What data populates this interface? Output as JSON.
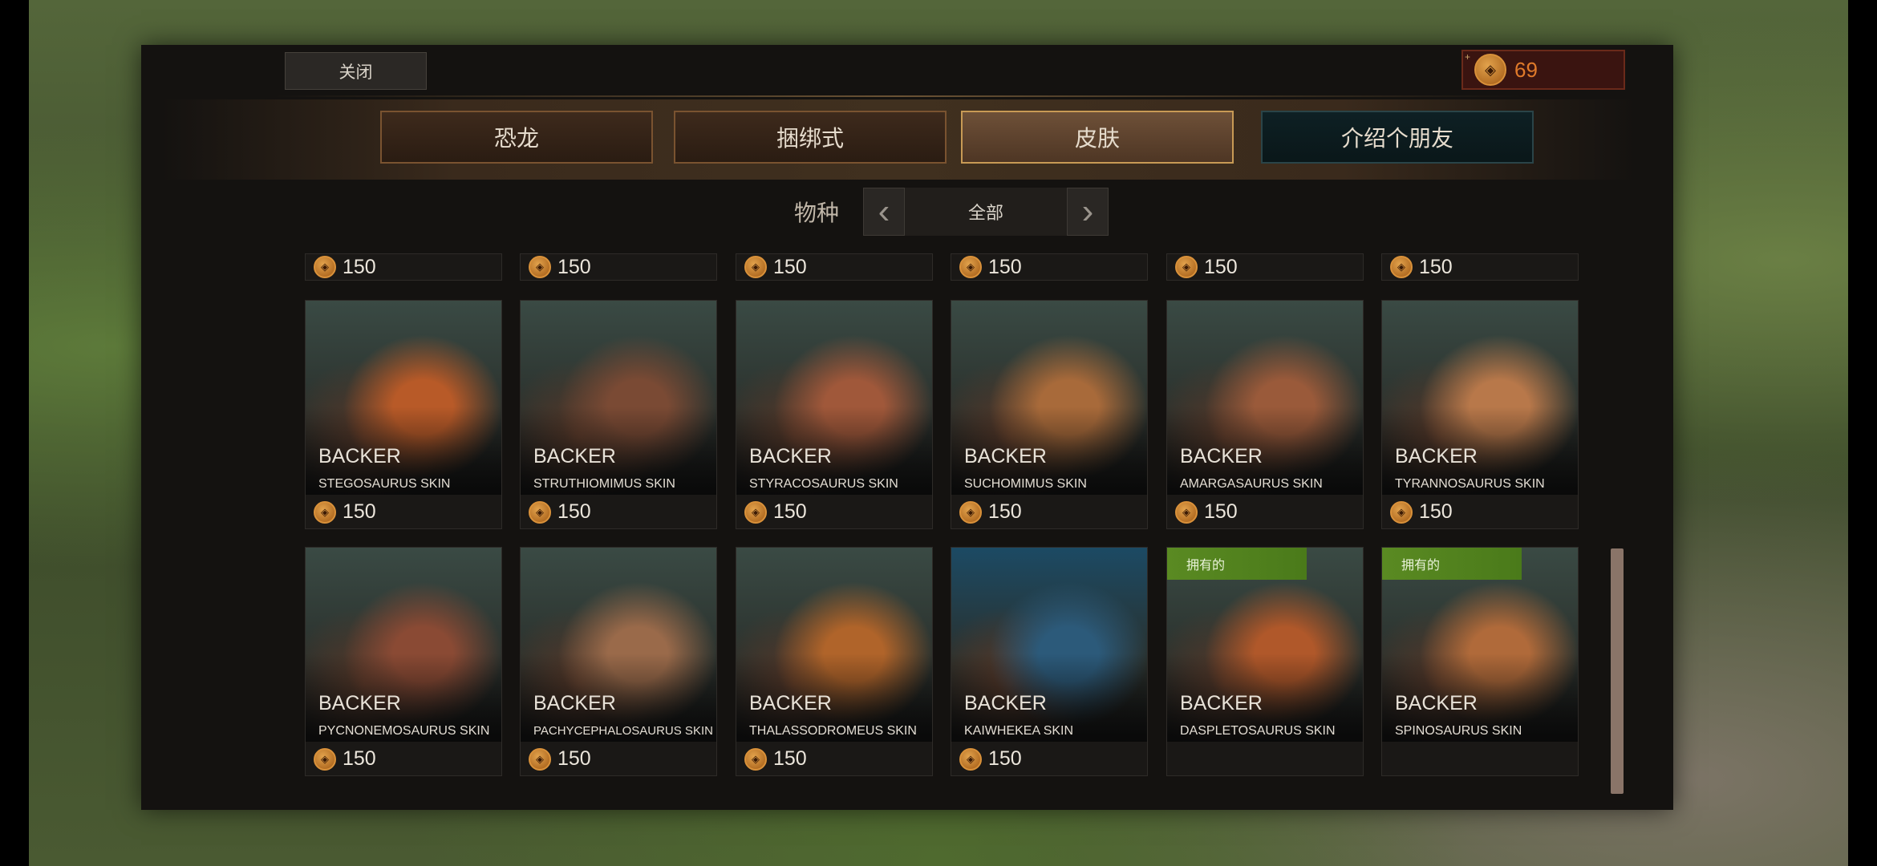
{
  "topbar": {
    "close_label": "关闭",
    "currency_plus": "+",
    "currency_amount": "69"
  },
  "tabs": [
    {
      "label": "恐龙",
      "active": false
    },
    {
      "label": "捆绑式",
      "active": false
    },
    {
      "label": "皮肤",
      "active": true
    },
    {
      "label": "介绍个朋友",
      "active": false
    }
  ],
  "filter": {
    "label": "物种",
    "value": "全部",
    "prev_icon": "chevron-left-icon",
    "next_icon": "chevron-right-icon"
  },
  "top_row_prices": [
    "150",
    "150",
    "150",
    "150",
    "150",
    "150"
  ],
  "rows": [
    [
      {
        "tier": "BACKER",
        "name": "STEGOSAURUS SKIN",
        "price": "150",
        "owned": false,
        "owned_label": "",
        "art_color": "#b85a28"
      },
      {
        "tier": "BACKER",
        "name": "STRUTHIOMIMUS SKIN",
        "price": "150",
        "owned": false,
        "owned_label": "",
        "art_color": "#7a4a34"
      },
      {
        "tier": "BACKER",
        "name": "STYRACOSAURUS SKIN",
        "price": "150",
        "owned": false,
        "owned_label": "",
        "art_color": "#a0583a"
      },
      {
        "tier": "BACKER",
        "name": "SUCHOMIMUS SKIN",
        "price": "150",
        "owned": false,
        "owned_label": "",
        "art_color": "#a86a3a"
      },
      {
        "tier": "BACKER",
        "name": "AMARGASAURUS SKIN",
        "price": "150",
        "owned": false,
        "owned_label": "",
        "art_color": "#9a5a3a"
      },
      {
        "tier": "BACKER",
        "name": "TYRANNOSAURUS SKIN",
        "price": "150",
        "owned": false,
        "owned_label": "",
        "art_color": "#b8784a"
      }
    ],
    [
      {
        "tier": "BACKER",
        "name": "PYCNONEMOSAURUS SKIN",
        "price": "150",
        "owned": false,
        "owned_label": "",
        "art_color": "#8a4a34"
      },
      {
        "tier": "BACKER",
        "name": "PACHYCEPHALOSAURUS SKIN",
        "price": "150",
        "owned": false,
        "owned_label": "",
        "art_color": "#9a6a4a"
      },
      {
        "tier": "BACKER",
        "name": "THALASSODROMEUS SKIN",
        "price": "150",
        "owned": false,
        "owned_label": "",
        "art_color": "#b0642a"
      },
      {
        "tier": "BACKER",
        "name": "KAIWHEKEA SKIN",
        "price": "150",
        "owned": false,
        "owned_label": "",
        "art_color": "#2c5a7a"
      },
      {
        "tier": "BACKER",
        "name": "DASPLETOSAURUS SKIN",
        "price": "",
        "owned": true,
        "owned_label": "拥有的",
        "art_color": "#b0582a"
      },
      {
        "tier": "BACKER",
        "name": "SPINOSAURUS SKIN",
        "price": "",
        "owned": true,
        "owned_label": "拥有的",
        "art_color": "#b06a3a"
      }
    ]
  ],
  "colors": {
    "accent_orange": "#e07a2a",
    "owned_green": "#5a8a22",
    "active_tab": "#c89a55"
  },
  "icons": {
    "currency": "dino-coin-icon"
  }
}
